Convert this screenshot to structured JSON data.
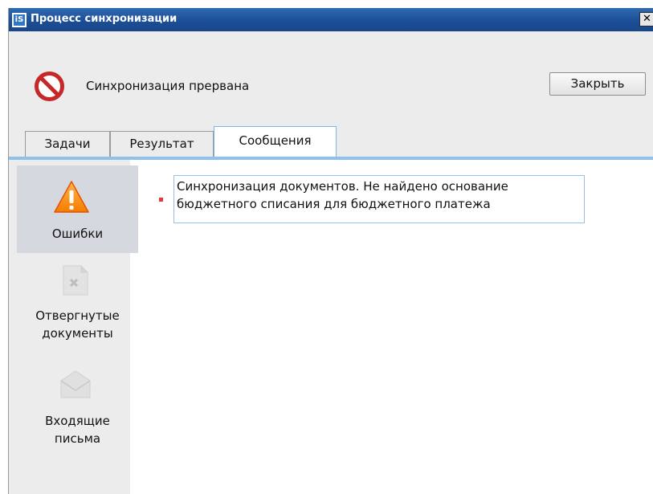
{
  "window": {
    "title": "Процесс синхронизации",
    "close_glyph": "✕"
  },
  "status": {
    "icon": "no-entry-icon",
    "text": "Синхронизация прервана"
  },
  "toolbar": {
    "close_label": "Закрыть"
  },
  "tabs": [
    {
      "label": "Задачи",
      "active": false
    },
    {
      "label": "Результат",
      "active": false
    },
    {
      "label": "Сообщения",
      "active": true
    }
  ],
  "sidebar": {
    "items": [
      {
        "label": "Ошибки",
        "icon": "warning-icon",
        "active": true
      },
      {
        "label_line1": "Отвергнутые",
        "label_line2": "документы",
        "icon": "rejected-document-icon",
        "active": false
      },
      {
        "label_line1": "Входящие",
        "label_line2": "письма",
        "icon": "envelope-icon",
        "active": false
      }
    ]
  },
  "messages": [
    {
      "line1": "Синхронизация документов. Не найдено основание",
      "line2": "бюджетного списания для бюджетного платежа"
    }
  ],
  "colors": {
    "title_bar": "#1c4f97",
    "tab_accent": "#8fc1ec",
    "error_red": "#e53935"
  }
}
